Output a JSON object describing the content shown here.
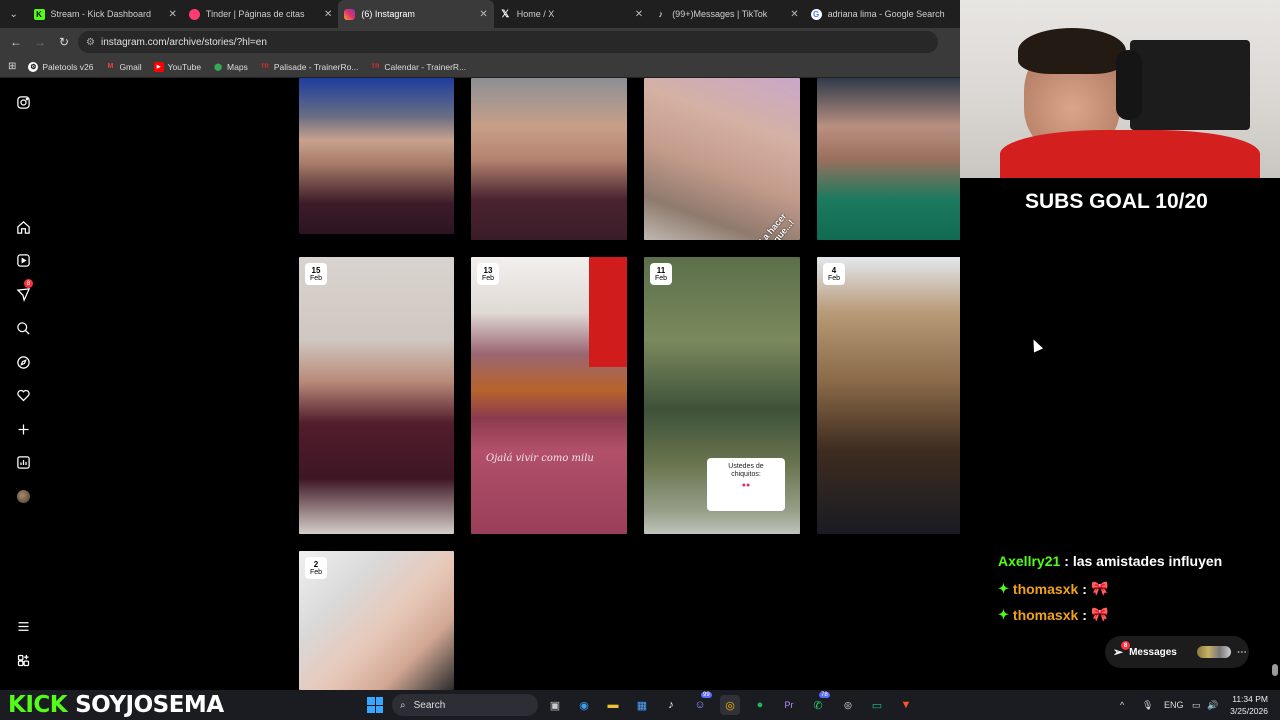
{
  "browser": {
    "tabs": [
      {
        "label": "Stream - Kick Dashboard",
        "icon": "kick-icon",
        "color": "#53fc18",
        "active": false
      },
      {
        "label": "Tinder | Páginas de citas",
        "icon": "tinder-icon",
        "color": "#fe3c72",
        "active": false
      },
      {
        "label": "(6) Instagram",
        "icon": "instagram-icon",
        "color": "#e1306c",
        "active": true
      },
      {
        "label": "Home / X",
        "icon": "x-icon",
        "color": "#ffffff",
        "active": false
      },
      {
        "label": "(99+)Messages | TikTok",
        "icon": "tiktok-icon",
        "color": "#000000",
        "active": false
      },
      {
        "label": "adriana lima - Google Search",
        "icon": "google-icon",
        "color": "#ffffff",
        "active": false
      }
    ],
    "url": "instagram.com/archive/stories/?hl=en",
    "bookmarks": [
      {
        "label": "Paletools v26",
        "icon": "paletools-icon",
        "color": "#ffffff"
      },
      {
        "label": "Gmail",
        "icon": "gmail-icon",
        "color": "#ea4335"
      },
      {
        "label": "YouTube",
        "icon": "youtube-icon",
        "color": "#ff0000"
      },
      {
        "label": "Maps",
        "icon": "maps-icon",
        "color": "#34a853"
      },
      {
        "label": "Palisade - TrainerRo...",
        "icon": "trainerroad-icon",
        "color": "#d92b2b"
      },
      {
        "label": "Calendar - TrainerR...",
        "icon": "trainerroad-icon",
        "color": "#d92b2b"
      }
    ]
  },
  "instagram": {
    "nav_badge": "8",
    "stories": [
      {
        "day": "",
        "month": "",
        "caption": ""
      },
      {
        "day": "",
        "month": "",
        "caption": ""
      },
      {
        "day": "",
        "month": "",
        "caption": "Cogí mi celu y le dije: ¡vamo' a hacer lo que...!"
      },
      {
        "day": "",
        "month": "",
        "caption": ""
      },
      {
        "day": "15",
        "month": "Feb",
        "caption": ""
      },
      {
        "day": "13",
        "month": "Feb",
        "caption": "Ojalá vivir como milu"
      },
      {
        "day": "11",
        "month": "Feb",
        "caption": "Ustedes de chiquitos:"
      },
      {
        "day": "4",
        "month": "Feb",
        "caption": ""
      },
      {
        "day": "2",
        "month": "Feb",
        "caption": ""
      }
    ],
    "messages_label": "Messages",
    "messages_badge": "8"
  },
  "stream_overlay": {
    "subs_goal": "SUBS GOAL 10/20",
    "chat": [
      {
        "user": "Axellry21",
        "message": ": las amistades influyen",
        "badge": ""
      },
      {
        "user": "thomasxk",
        "message": ":",
        "badge": "✦",
        "emote": "🎀"
      },
      {
        "user": "thomasxk",
        "message": ":",
        "badge": "✦",
        "emote": "🎀"
      }
    ],
    "brand_kick": "KICK",
    "brand_user": "SOYJOSEMA"
  },
  "taskbar": {
    "search_placeholder": "Search",
    "lang": "ENG",
    "time": "11:34 PM",
    "date": "3/25/2026",
    "badge_discord": "99",
    "badge_whatsapp": "78"
  },
  "colors": {
    "kick_green": "#53fc18",
    "chat_orange": "#f0a21b",
    "ig_red": "#ff3040"
  }
}
